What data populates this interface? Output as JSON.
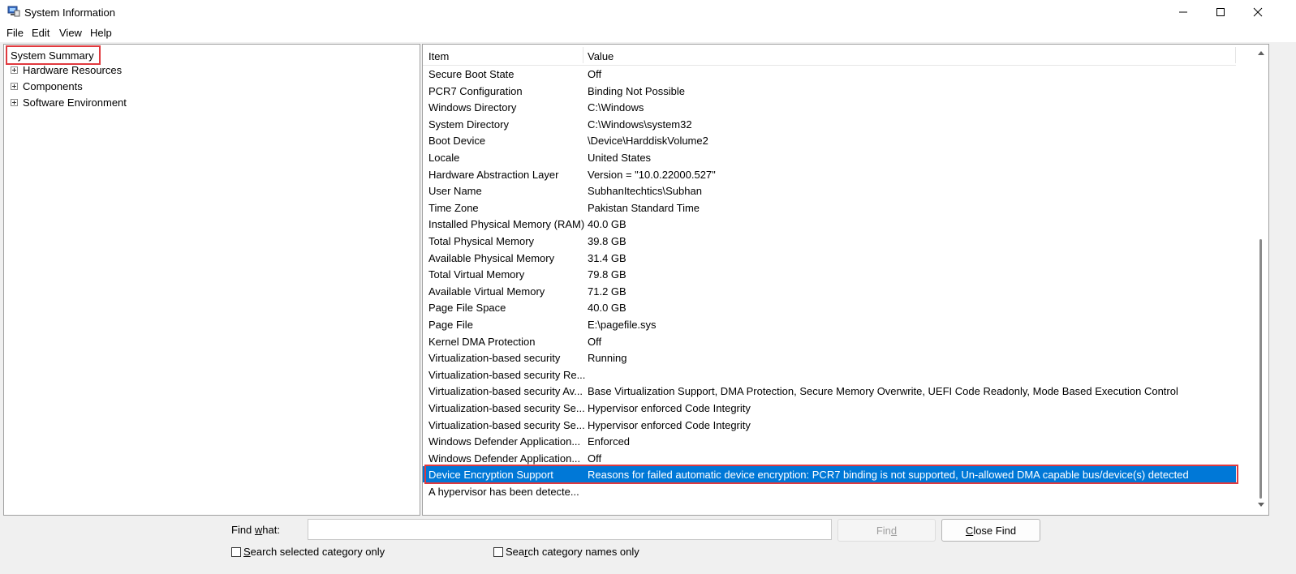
{
  "window": {
    "title": "System Information"
  },
  "menu": {
    "file": "File",
    "edit": "Edit",
    "view": "View",
    "help": "Help"
  },
  "tree": {
    "root": "System Summary",
    "children": [
      "Hardware Resources",
      "Components",
      "Software Environment"
    ]
  },
  "table": {
    "headers": {
      "item": "Item",
      "value": "Value"
    },
    "rows": [
      {
        "item": "Secure Boot State",
        "value": "Off"
      },
      {
        "item": "PCR7 Configuration",
        "value": "Binding Not Possible"
      },
      {
        "item": "Windows Directory",
        "value": "C:\\Windows"
      },
      {
        "item": "System Directory",
        "value": "C:\\Windows\\system32"
      },
      {
        "item": "Boot Device",
        "value": "\\Device\\HarddiskVolume2"
      },
      {
        "item": "Locale",
        "value": "United States"
      },
      {
        "item": "Hardware Abstraction Layer",
        "value": "Version = \"10.0.22000.527\""
      },
      {
        "item": "User Name",
        "value": "SubhanItechtics\\Subhan"
      },
      {
        "item": "Time Zone",
        "value": "Pakistan Standard Time"
      },
      {
        "item": "Installed Physical Memory (RAM)",
        "value": "40.0 GB"
      },
      {
        "item": "Total Physical Memory",
        "value": "39.8 GB"
      },
      {
        "item": "Available Physical Memory",
        "value": "31.4 GB"
      },
      {
        "item": "Total Virtual Memory",
        "value": "79.8 GB"
      },
      {
        "item": "Available Virtual Memory",
        "value": "71.2 GB"
      },
      {
        "item": "Page File Space",
        "value": "40.0 GB"
      },
      {
        "item": "Page File",
        "value": "E:\\pagefile.sys"
      },
      {
        "item": "Kernel DMA Protection",
        "value": "Off"
      },
      {
        "item": "Virtualization-based security",
        "value": "Running"
      },
      {
        "item": "Virtualization-based security Re...",
        "value": ""
      },
      {
        "item": "Virtualization-based security Av...",
        "value": "Base Virtualization Support, DMA Protection, Secure Memory Overwrite, UEFI Code Readonly, Mode Based Execution Control"
      },
      {
        "item": "Virtualization-based security Se...",
        "value": "Hypervisor enforced Code Integrity"
      },
      {
        "item": "Virtualization-based security Se...",
        "value": "Hypervisor enforced Code Integrity"
      },
      {
        "item": "Windows Defender Application...",
        "value": "Enforced"
      },
      {
        "item": "Windows Defender Application...",
        "value": "Off"
      },
      {
        "item": "Device Encryption Support",
        "value": "Reasons for failed automatic device encryption: PCR7 binding is not supported, Un-allowed DMA capable bus/device(s) detected"
      },
      {
        "item": "A hypervisor has been detecte...",
        "value": ""
      }
    ]
  },
  "find": {
    "label_pre": "Find ",
    "label_key": "w",
    "label_post": "hat:",
    "value": "",
    "find_pre": "Fin",
    "find_key": "d",
    "find_post": "",
    "close_pre": "",
    "close_key": "C",
    "close_post": "lose Find",
    "search_selected_pre": "",
    "search_selected_key": "S",
    "search_selected_post": "earch selected category only",
    "search_names_pre": "Sea",
    "search_names_key": "r",
    "search_names_post": "ch category names only"
  },
  "colors": {
    "selection": "#0078d7",
    "highlight_box": "#e0393e"
  }
}
